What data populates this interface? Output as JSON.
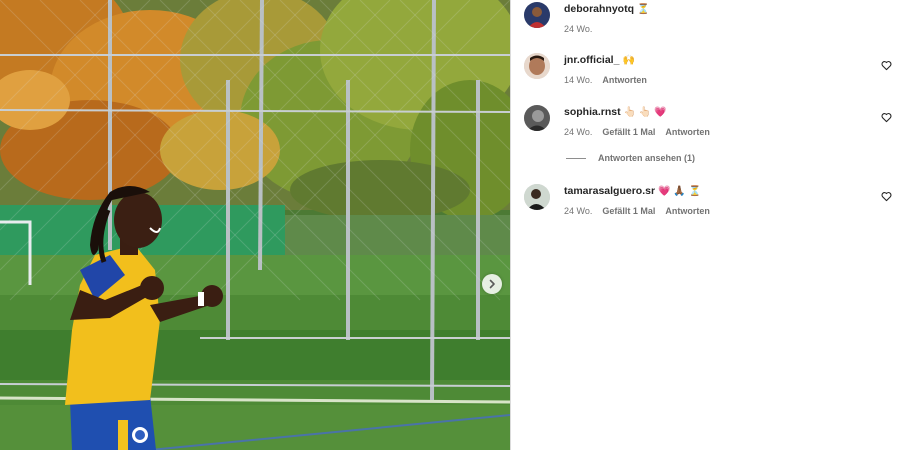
{
  "colors": {
    "text": "#262626",
    "secondary": "#737373",
    "heart_red": "#ed4956",
    "border": "#dbdbdb"
  },
  "photo": {
    "next_icon": "chevron-right-icon"
  },
  "comments": [
    {
      "username": "deborahnyotq",
      "emoji": "⏳",
      "time": "24 Wo.",
      "likes": "",
      "reply": "",
      "avatar_icon": "profile-photo"
    },
    {
      "username": "jnr.official_",
      "emoji": "🙌",
      "time": "14 Wo.",
      "likes": "",
      "reply": "Antworten",
      "avatar_icon": "profile-photo"
    },
    {
      "username": "sophia.rnst",
      "emoji": "👆🏻 👆🏻 💗",
      "time": "24 Wo.",
      "likes": "Gefällt 1 Mal",
      "reply": "Antworten",
      "avatar_icon": "profile-photo"
    },
    {
      "username": "tamarasalguero.sr",
      "emoji": "💗 🙏🏾 ⏳",
      "time": "24 Wo.",
      "likes": "Gefällt 1 Mal",
      "reply": "Antworten",
      "avatar_icon": "profile-photo"
    }
  ],
  "view_replies": "Antworten ansehen (1)"
}
